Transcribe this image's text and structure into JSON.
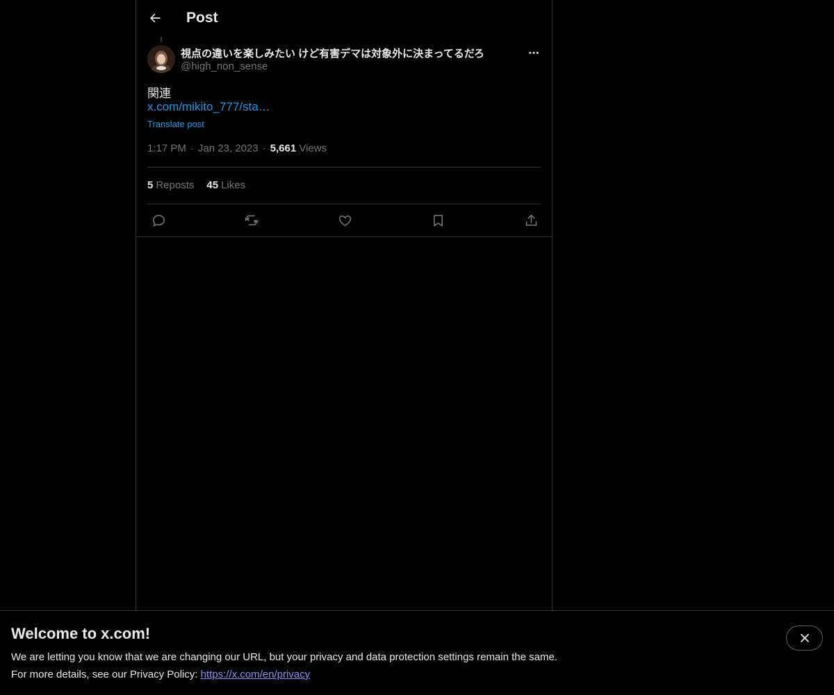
{
  "header": {
    "title": "Post",
    "back_icon": "arrow-left-icon"
  },
  "post": {
    "author": {
      "display_name": "視点の違いを楽しみたい けど有害デマは対象外に決まってるだろ",
      "handle": "@high_non_sense"
    },
    "text": "関連",
    "link_text": "x.com/mikito_777/sta…",
    "translate_label": "Translate post",
    "time": "1:17 PM",
    "date": "Jan 23, 2023",
    "views_count": "5,661",
    "views_label": "Views",
    "separator": "·",
    "reposts_count": "5",
    "reposts_label": "Reposts",
    "likes_count": "45",
    "likes_label": "Likes"
  },
  "actions": [
    "reply-icon",
    "repost-icon",
    "like-icon",
    "bookmark-icon",
    "share-icon"
  ],
  "banner": {
    "title": "Welcome to x.com!",
    "line1": "We are letting you know that we are changing our URL, but your privacy and data protection settings remain the same.",
    "line2_prefix": "For more details, see our Privacy Policy: ",
    "link": "https://x.com/en/privacy"
  },
  "colors": {
    "background": "#000000",
    "text_primary": "#e7e9ea",
    "text_secondary": "#71767b",
    "accent": "#1d9bf0",
    "border": "#2f3336",
    "banner_link": "#8f8ff7"
  }
}
